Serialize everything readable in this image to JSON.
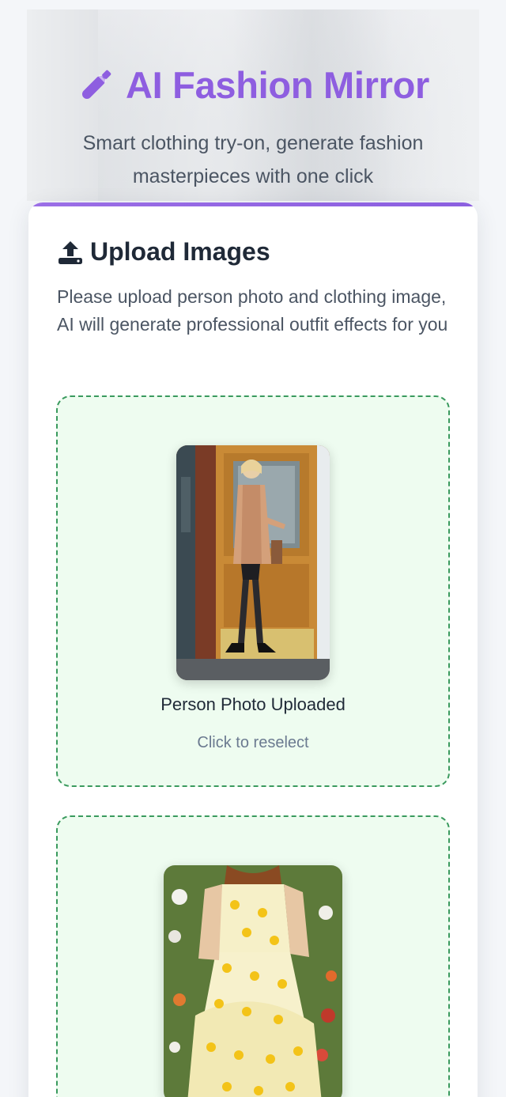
{
  "header": {
    "title": "AI Fashion Mirror",
    "subtitle": "Smart clothing try-on, generate fashion masterpieces with one click",
    "accent_color": "#8e5ee0",
    "icon": "paintbrush-icon"
  },
  "upload": {
    "heading": "Upload Images",
    "icon": "upload-icon",
    "description": "Please upload person photo and clothing image, AI will generate professional outfit effects for you",
    "person_zone": {
      "status": "Person Photo Uploaded",
      "hint": "Click to reselect",
      "border_color": "#3a9a5e"
    },
    "clothing_zone": {
      "border_color": "#3a9a5e"
    }
  }
}
